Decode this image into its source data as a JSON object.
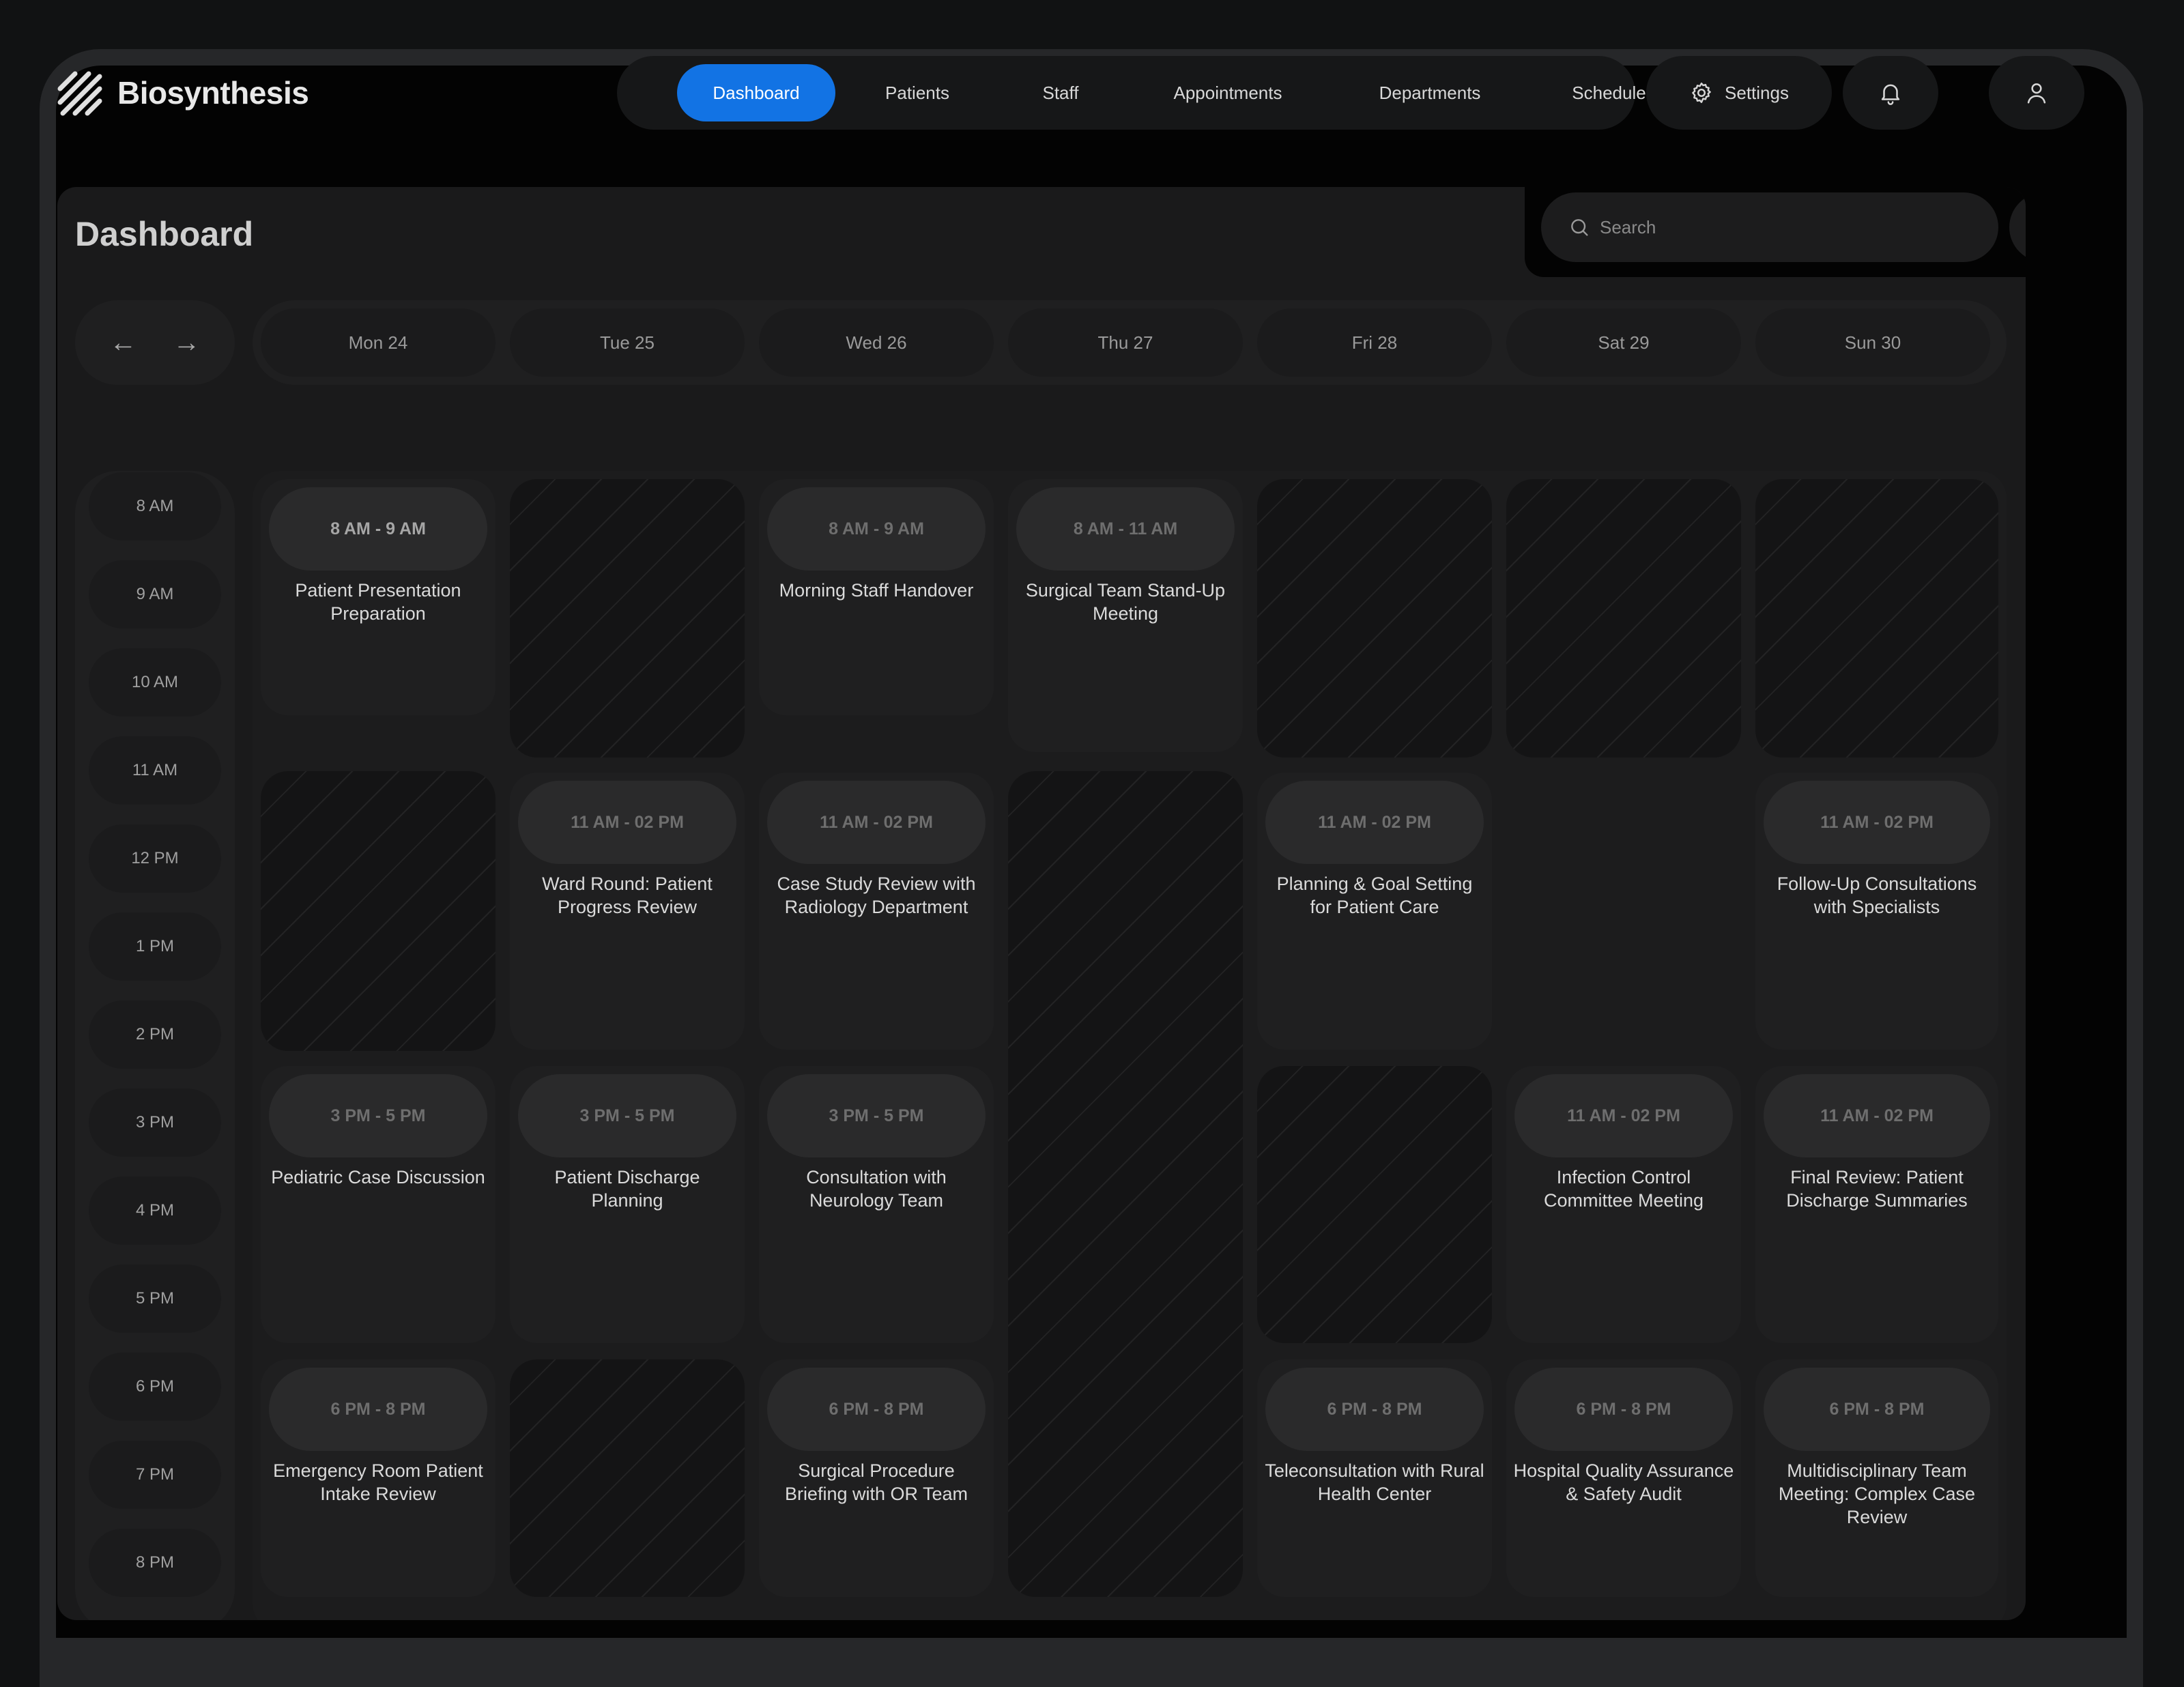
{
  "app": {
    "name": "Biosynthesis"
  },
  "nav": {
    "items": [
      "Dashboard",
      "Patients",
      "Staff",
      "Appointments",
      "Departments",
      "Schedules"
    ],
    "active": "Dashboard",
    "settings_label": "Settings"
  },
  "page": {
    "title": "Dashboard"
  },
  "search": {
    "placeholder": "Search"
  },
  "calendar": {
    "days": [
      "Mon 24",
      "Tue 25",
      "Wed 26",
      "Thu 27",
      "Fri 28",
      "Sat 29",
      "Sun 30"
    ],
    "times": [
      "8 AM",
      "9 AM",
      "10 AM",
      "11 AM",
      "12 PM",
      "1 PM",
      "2 PM",
      "3 PM",
      "4 PM",
      "5 PM",
      "6 PM",
      "7 PM",
      "8 PM"
    ],
    "events": {
      "mon": {
        "e1": {
          "time": "8 AM - 9 AM",
          "title": "Patient Presentation Preparation"
        },
        "e3": {
          "time": "3 PM - 5 PM",
          "title": "Pediatric Case Discussion"
        },
        "e4": {
          "time": "6 PM - 8 PM",
          "title": "Emergency Room Patient Intake Review"
        }
      },
      "tue": {
        "e2": {
          "time": "11 AM - 02 PM",
          "title": "Ward Round: Patient Progress Review"
        },
        "e3": {
          "time": "3 PM - 5 PM",
          "title": "Patient Discharge Planning"
        }
      },
      "wed": {
        "e1": {
          "time": "8 AM - 9 AM",
          "title": "Morning Staff Handover"
        },
        "e2": {
          "time": "11 AM - 02 PM",
          "title": "Case Study Review with Radiology Department"
        },
        "e3": {
          "time": "3 PM - 5 PM",
          "title": "Consultation with Neurology Team"
        },
        "e4": {
          "time": "6 PM - 8 PM",
          "title": "Surgical Procedure Briefing with OR Team"
        }
      },
      "thu": {
        "e1": {
          "time": "8 AM - 11 AM",
          "title": "Surgical Team Stand-Up Meeting"
        }
      },
      "fri": {
        "e2": {
          "time": "11 AM - 02 PM",
          "title": "Planning & Goal Setting for Patient Care"
        },
        "e4": {
          "time": "6 PM - 8 PM",
          "title": "Teleconsultation with Rural Health Center"
        }
      },
      "sat": {
        "e3": {
          "time": "11 AM - 02 PM",
          "title": "Infection Control Committee Meeting"
        },
        "e4": {
          "time": "6 PM - 8 PM",
          "title": "Hospital Quality Assurance & Safety Audit"
        }
      },
      "sun": {
        "e2": {
          "time": "11 AM - 02 PM",
          "title": "Follow-Up Consultations with Specialists"
        },
        "e3": {
          "time": "11 AM - 02 PM",
          "title": "Final Review: Patient Discharge Summaries"
        },
        "e4": {
          "time": "6 PM - 8 PM",
          "title": "Multidisciplinary Team Meeting: Complex Case Review"
        }
      }
    }
  },
  "colors": {
    "accent": "#1273e4",
    "background": "#030303",
    "surface": "#1a1a1b"
  },
  "icons": [
    "logo-icon",
    "settings-icon",
    "bell-icon",
    "user-icon",
    "search-icon",
    "filter-icon",
    "arrow-left-icon",
    "arrow-right-icon"
  ]
}
